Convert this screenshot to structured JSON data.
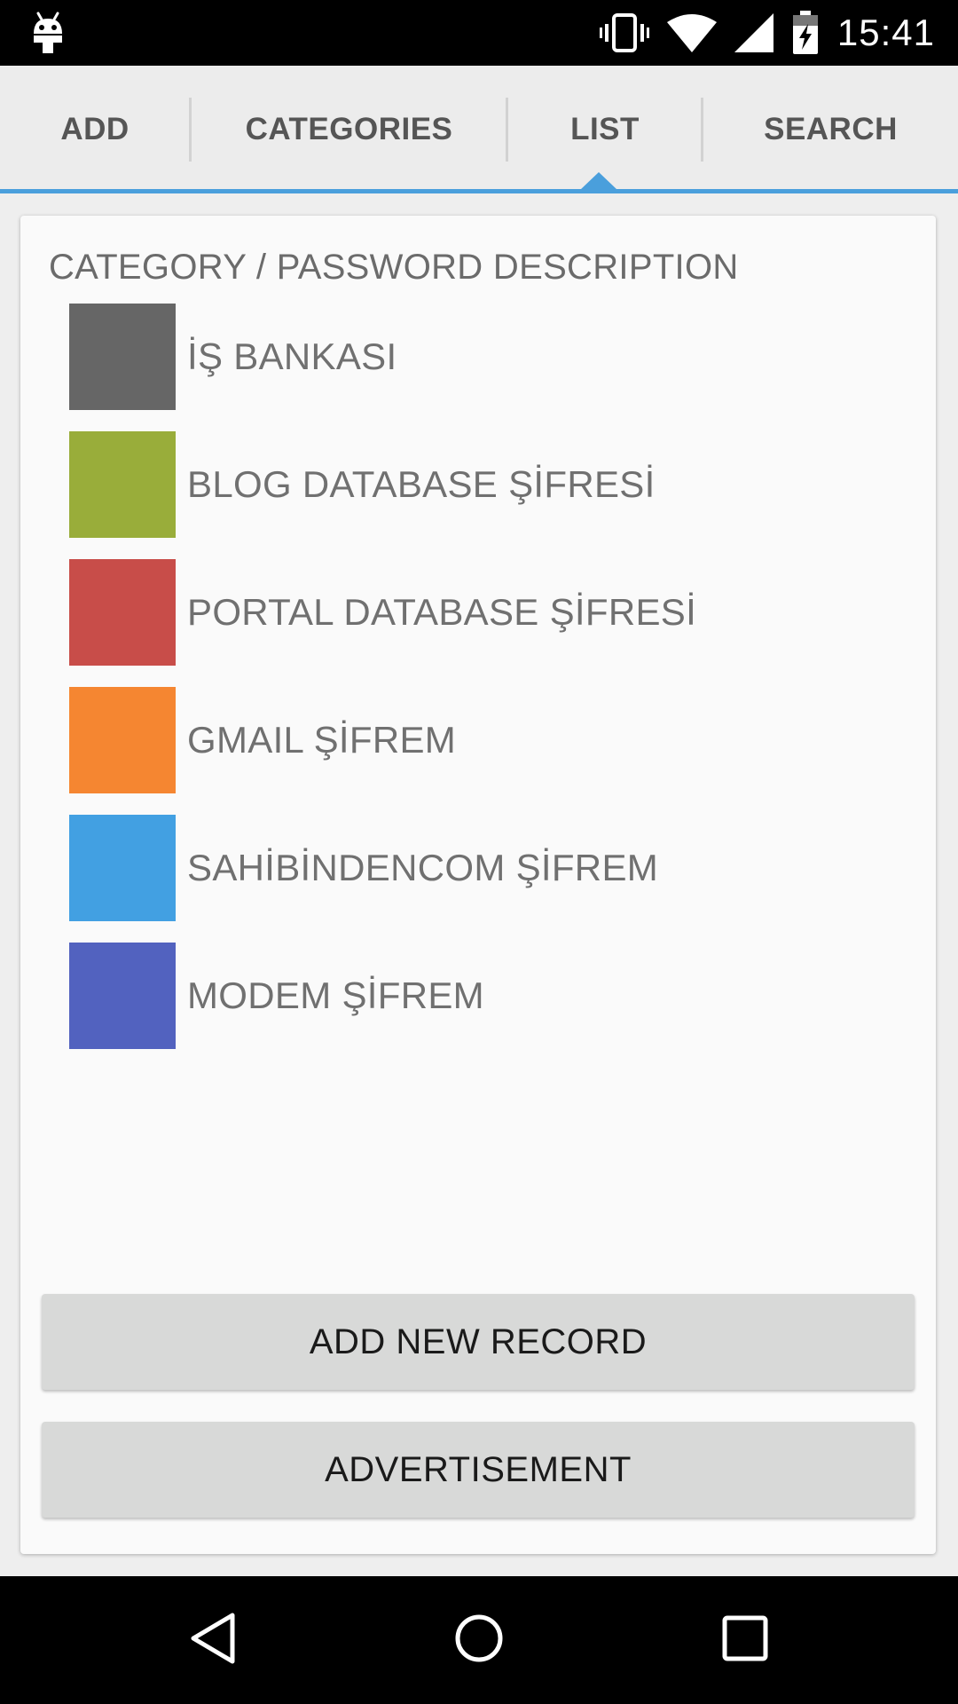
{
  "status_bar": {
    "time": "15:41",
    "icons": [
      "android-debug-icon",
      "vibrate-icon",
      "wifi-icon",
      "cell-signal-icon",
      "battery-charging-icon"
    ]
  },
  "tabs": [
    {
      "label": "ADD"
    },
    {
      "label": "CATEGORIES"
    },
    {
      "label": "LIST",
      "selected": true
    },
    {
      "label": "SEARCH"
    }
  ],
  "accent_color": "#4a9fdc",
  "list": {
    "header": "CATEGORY / PASSWORD DESCRIPTION",
    "items": [
      {
        "label": "İŞ BANKASI",
        "color": "#666666"
      },
      {
        "label": "BLOG DATABASE ŞİFRESİ",
        "color": "#99ad3a"
      },
      {
        "label": "PORTAL DATABASE ŞİFRESİ",
        "color": "#c84d49"
      },
      {
        "label": "GMAIL ŞİFREM",
        "color": "#f58631"
      },
      {
        "label": "SAHİBİNDENCOM ŞİFREM",
        "color": "#42a0e2"
      },
      {
        "label": "MODEM ŞİFREM",
        "color": "#5262bf"
      }
    ]
  },
  "buttons": {
    "add_new_record": "ADD NEW RECORD",
    "advertisement": "ADVERTISEMENT"
  },
  "nav_bar": {
    "icons": [
      "back-icon",
      "home-icon",
      "recents-icon"
    ]
  }
}
